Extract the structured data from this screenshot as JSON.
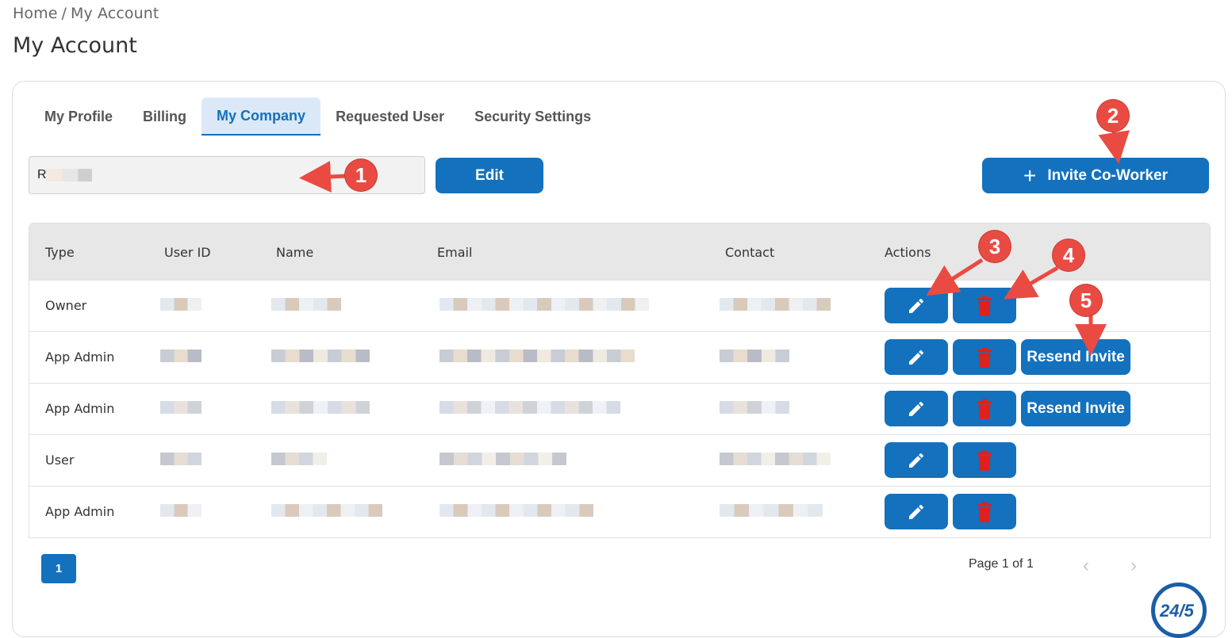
{
  "breadcrumb": {
    "home": "Home",
    "separator": "/",
    "current": "My Account"
  },
  "page_title": "My Account",
  "tabs": [
    {
      "label": "My Profile",
      "active": false
    },
    {
      "label": "Billing",
      "active": false
    },
    {
      "label": "My Company",
      "active": true
    },
    {
      "label": "Requested User",
      "active": false
    },
    {
      "label": "Security Settings",
      "active": false
    }
  ],
  "company": {
    "value": "R        st",
    "edit_label": "Edit"
  },
  "invite": {
    "icon": "plus-icon",
    "label": "Invite Co-Worker"
  },
  "table": {
    "headers": [
      "Type",
      "User ID",
      "Name",
      "Email",
      "Contact",
      "Actions"
    ],
    "rows": [
      {
        "type": "Owner",
        "resend": false
      },
      {
        "type": "App Admin",
        "resend": true
      },
      {
        "type": "App Admin",
        "resend": true
      },
      {
        "type": "User",
        "resend": false
      },
      {
        "type": "App Admin",
        "resend": false
      }
    ],
    "resend_label": "Resend Invite",
    "edit_icon": "pencil-icon",
    "delete_icon": "trash-icon"
  },
  "pagination": {
    "current_page": "1",
    "summary": "Page 1 of 1",
    "prev": "‹",
    "next": "›"
  },
  "callouts": [
    "1",
    "2",
    "3",
    "4",
    "5"
  ],
  "colors": {
    "primary": "#1371bd",
    "delete_icon": "#e0201b",
    "callout": "#e94b43"
  }
}
